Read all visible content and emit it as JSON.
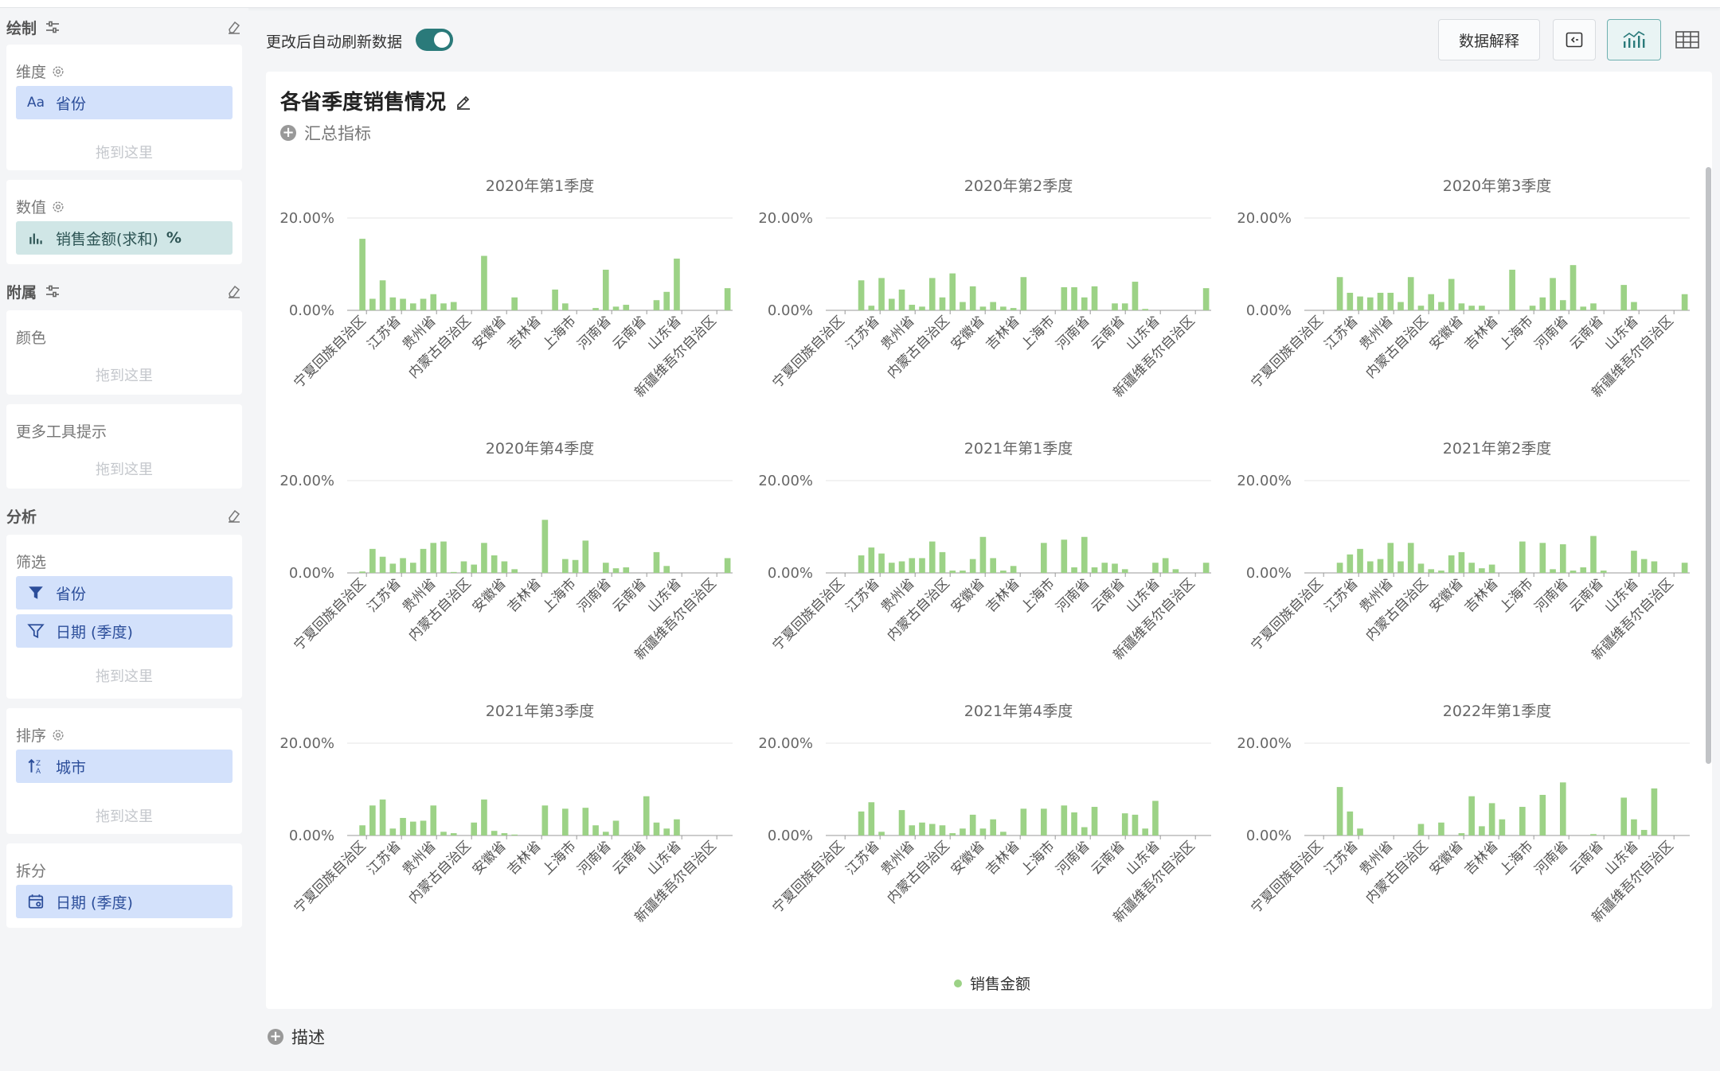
{
  "sidebar": {
    "draw": {
      "title": "绘制"
    },
    "dimension": {
      "title": "维度",
      "pill_icon": "Aa",
      "pill_label": "省份",
      "drop": "拖到这里"
    },
    "value": {
      "title": "数值",
      "pill_label": "销售金额(求和)",
      "pill_tail": "%"
    },
    "attach": {
      "title": "附属"
    },
    "color": {
      "title": "颜色",
      "drop": "拖到这里"
    },
    "tooltip": {
      "title": "更多工具提示",
      "drop": "拖到这里"
    },
    "analysis": {
      "title": "分析"
    },
    "filter": {
      "title": "筛选",
      "pill1": "省份",
      "pill2": "日期 (季度)",
      "drop": "拖到这里"
    },
    "sort": {
      "title": "排序",
      "pill_label": "城市",
      "drop": "拖到这里"
    },
    "split": {
      "title": "拆分",
      "pill_label": "日期 (季度)"
    }
  },
  "toolbar": {
    "auto_refresh_label": "更改后自动刷新数据",
    "auto_refresh_on": true,
    "explain_button": "数据解释"
  },
  "chart_panel": {
    "title": "各省季度销售情况",
    "add_metric": "汇总指标",
    "description": "描述",
    "legend_label": "销售金额",
    "bar_color": "#9cd286"
  },
  "chart_data": [
    {
      "type": "bar",
      "title": "2020年第1季度",
      "ylabel_ticks": [
        "0.00%",
        "20.00%"
      ],
      "ylim": [
        0,
        0.2
      ],
      "tick_labels": [
        "宁夏回族自治区",
        "江苏省",
        "贵州省",
        "内蒙古自治区",
        "安徽省",
        "吉林省",
        "上海市",
        "河南省",
        "云南省",
        "山东省",
        "新疆维吾尔自治区"
      ],
      "values": [
        0,
        0.155,
        0.025,
        0.065,
        0.028,
        0.025,
        0.015,
        0.025,
        0.035,
        0.015,
        0.018,
        0,
        0,
        0.118,
        0,
        0,
        0.028,
        0,
        0,
        0,
        0.045,
        0.015,
        0,
        0,
        0.005,
        0.088,
        0.008,
        0.012,
        0,
        0,
        0.022,
        0.04,
        0.112,
        0,
        0,
        0,
        0,
        0.048
      ]
    },
    {
      "type": "bar",
      "title": "2020年第2季度",
      "ylabel_ticks": [
        "0.00%",
        "20.00%"
      ],
      "ylim": [
        0,
        0.2
      ],
      "tick_labels": [
        "宁夏回族自治区",
        "江苏省",
        "贵州省",
        "内蒙古自治区",
        "安徽省",
        "吉林省",
        "上海市",
        "河南省",
        "云南省",
        "山东省",
        "新疆维吾尔自治区"
      ],
      "values": [
        0,
        0,
        0,
        0.065,
        0.01,
        0.07,
        0.025,
        0.045,
        0.012,
        0.008,
        0.07,
        0.028,
        0.08,
        0.018,
        0.052,
        0.008,
        0.018,
        0.008,
        0.005,
        0.072,
        0,
        0,
        0,
        0.05,
        0.05,
        0.028,
        0.052,
        0,
        0.015,
        0.015,
        0.062,
        0.003,
        0,
        0,
        0,
        0,
        0,
        0.048
      ]
    },
    {
      "type": "bar",
      "title": "2020年第3季度",
      "ylabel_ticks": [
        "0.00%",
        "20.00%"
      ],
      "ylim": [
        0,
        0.2
      ],
      "tick_labels": [
        "宁夏回族自治区",
        "江苏省",
        "贵州省",
        "内蒙古自治区",
        "安徽省",
        "吉林省",
        "上海市",
        "河南省",
        "云南省",
        "山东省",
        "新疆维吾尔自治区"
      ],
      "values": [
        0,
        0,
        0,
        0.072,
        0.038,
        0.03,
        0.028,
        0.038,
        0.038,
        0.018,
        0.072,
        0.01,
        0.035,
        0.018,
        0.068,
        0.015,
        0.01,
        0.01,
        0,
        0,
        0.088,
        0,
        0.01,
        0.028,
        0.07,
        0.022,
        0.098,
        0.008,
        0.015,
        0,
        0,
        0.055,
        0.018,
        0,
        0,
        0,
        0,
        0.035
      ]
    },
    {
      "type": "bar",
      "title": "2020年第4季度",
      "ylabel_ticks": [
        "0.00%",
        "20.00%"
      ],
      "ylim": [
        0,
        0.2
      ],
      "tick_labels": [
        "宁夏回族自治区",
        "江苏省",
        "贵州省",
        "内蒙古自治区",
        "安徽省",
        "吉林省",
        "上海市",
        "河南省",
        "云南省",
        "山东省",
        "新疆维吾尔自治区"
      ],
      "values": [
        0,
        0.003,
        0.052,
        0.035,
        0.02,
        0.032,
        0.022,
        0.052,
        0.065,
        0.068,
        0.002,
        0.025,
        0.018,
        0.065,
        0.038,
        0.025,
        0.008,
        0,
        0,
        0.115,
        0,
        0.03,
        0.028,
        0.07,
        0,
        0.022,
        0.01,
        0.012,
        0,
        0,
        0.045,
        0.015,
        0,
        0,
        0,
        0,
        0,
        0.032
      ]
    },
    {
      "type": "bar",
      "title": "2021年第1季度",
      "ylabel_ticks": [
        "0.00%",
        "20.00%"
      ],
      "ylim": [
        0,
        0.2
      ],
      "tick_labels": [
        "宁夏回族自治区",
        "江苏省",
        "贵州省",
        "内蒙古自治区",
        "安徽省",
        "吉林省",
        "上海市",
        "河南省",
        "云南省",
        "山东省",
        "新疆维吾尔自治区"
      ],
      "values": [
        0,
        0,
        0,
        0.038,
        0.055,
        0.042,
        0.022,
        0.025,
        0.032,
        0.032,
        0.068,
        0.045,
        0.005,
        0.005,
        0.03,
        0.078,
        0.032,
        0.005,
        0.015,
        0,
        0,
        0.065,
        0,
        0.072,
        0.012,
        0.078,
        0.012,
        0.022,
        0.02,
        0.008,
        0,
        0,
        0.022,
        0.032,
        0.008,
        0,
        0,
        0.022
      ]
    },
    {
      "type": "bar",
      "title": "2021年第2季度",
      "ylabel_ticks": [
        "0.00%",
        "20.00%"
      ],
      "ylim": [
        0,
        0.2
      ],
      "tick_labels": [
        "宁夏回族自治区",
        "江苏省",
        "贵州省",
        "内蒙古自治区",
        "安徽省",
        "吉林省",
        "上海市",
        "河南省",
        "云南省",
        "山东省",
        "新疆维吾尔自治区"
      ],
      "values": [
        0,
        0,
        0,
        0.022,
        0.04,
        0.052,
        0.025,
        0.03,
        0.065,
        0.025,
        0.065,
        0.02,
        0.008,
        0.005,
        0.038,
        0.045,
        0.022,
        0.01,
        0.018,
        0,
        0,
        0.068,
        0,
        0.065,
        0.008,
        0.062,
        0.005,
        0.012,
        0.08,
        0.005,
        0,
        0,
        0.048,
        0.03,
        0.025,
        0,
        0,
        0.022
      ]
    },
    {
      "type": "bar",
      "title": "2021年第3季度",
      "ylabel_ticks": [
        "0.00%",
        "20.00%"
      ],
      "ylim": [
        0,
        0.2
      ],
      "tick_labels": [
        "宁夏回族自治区",
        "江苏省",
        "贵州省",
        "内蒙古自治区",
        "安徽省",
        "吉林省",
        "上海市",
        "河南省",
        "云南省",
        "山东省",
        "新疆维吾尔自治区"
      ],
      "values": [
        0,
        0.022,
        0.065,
        0.078,
        0.015,
        0.038,
        0.03,
        0.032,
        0.065,
        0.008,
        0.005,
        0,
        0.028,
        0.078,
        0.01,
        0.005,
        0.002,
        0,
        0,
        0.065,
        0,
        0.058,
        0,
        0.06,
        0.022,
        0.008,
        0.032,
        0,
        0,
        0.085,
        0.028,
        0.015,
        0.035,
        0,
        0,
        0,
        0,
        0
      ]
    },
    {
      "type": "bar",
      "title": "2021年第4季度",
      "ylabel_ticks": [
        "0.00%",
        "20.00%"
      ],
      "ylim": [
        0,
        0.2
      ],
      "tick_labels": [
        "宁夏回族自治区",
        "江苏省",
        "贵州省",
        "内蒙古自治区",
        "安徽省",
        "吉林省",
        "上海市",
        "河南省",
        "云南省",
        "山东省",
        "新疆维吾尔自治区"
      ],
      "values": [
        0,
        0,
        0,
        0.052,
        0.072,
        0.008,
        0,
        0.055,
        0.022,
        0.028,
        0.025,
        0.022,
        0.005,
        0.015,
        0.045,
        0.015,
        0.035,
        0.008,
        0,
        0.058,
        0,
        0.058,
        0,
        0.065,
        0.05,
        0.018,
        0.062,
        0,
        0,
        0.048,
        0.045,
        0.015,
        0.075,
        0,
        0,
        0,
        0,
        0
      ]
    },
    {
      "type": "bar",
      "title": "2022年第1季度",
      "ylabel_ticks": [
        "0.00%",
        "20.00%"
      ],
      "ylim": [
        0,
        0.2
      ],
      "tick_labels": [
        "宁夏回族自治区",
        "江苏省",
        "贵州省",
        "内蒙古自治区",
        "安徽省",
        "吉林省",
        "上海市",
        "河南省",
        "云南省",
        "山东省",
        "新疆维吾尔自治区"
      ],
      "values": [
        0,
        0,
        0,
        0.105,
        0.052,
        0.015,
        0,
        0,
        0,
        0,
        0,
        0.025,
        0,
        0.028,
        0,
        0.005,
        0.085,
        0.02,
        0.07,
        0.035,
        0,
        0.062,
        0,
        0.088,
        0,
        0.115,
        0,
        0,
        0.003,
        0,
        0,
        0.082,
        0.035,
        0.012,
        0.102,
        0,
        0,
        0
      ]
    }
  ]
}
